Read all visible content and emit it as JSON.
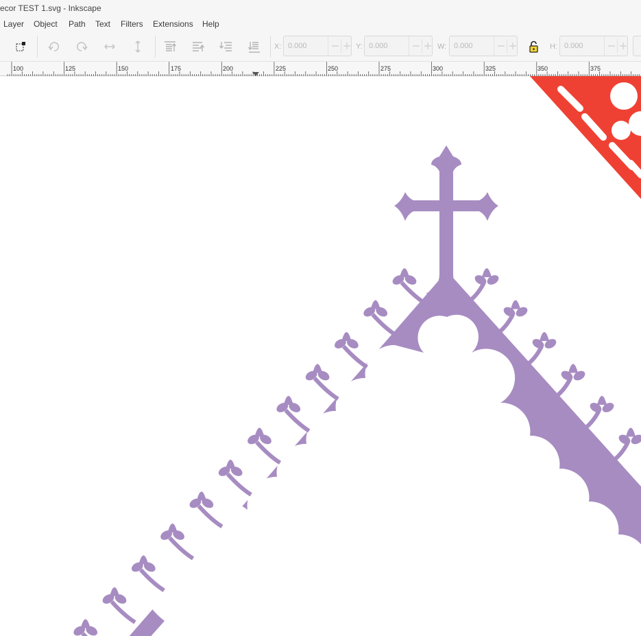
{
  "window": {
    "title": "ecor TEST 1.svg - Inkscape"
  },
  "menu": [
    "Layer",
    "Object",
    "Path",
    "Text",
    "Filters",
    "Extensions",
    "Help"
  ],
  "toolbar": {
    "x": {
      "label": "X:",
      "value": "0.000"
    },
    "y": {
      "label": "Y:",
      "value": "0.000"
    },
    "w": {
      "label": "W:",
      "value": "0.000"
    },
    "h": {
      "label": "H:",
      "value": "0.000"
    }
  },
  "ruler": {
    "labels": [
      "100",
      "125",
      "150",
      "175",
      "200",
      "225",
      "250",
      "275",
      "300",
      "325",
      "350",
      "375"
    ]
  },
  "canvas": {
    "ornament_color": "#a78cc2",
    "corner_color": "#ef4133"
  }
}
